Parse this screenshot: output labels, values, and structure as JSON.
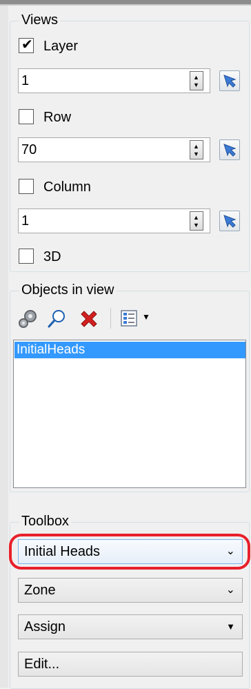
{
  "views": {
    "title": "Views",
    "layer": {
      "label": "Layer",
      "checked": true,
      "value": "1"
    },
    "row": {
      "label": "Row",
      "checked": false,
      "value": "70"
    },
    "column": {
      "label": "Column",
      "checked": false,
      "value": "1"
    },
    "three_d": {
      "label": "3D",
      "checked": false
    }
  },
  "objects": {
    "title": "Objects in view",
    "toolbar": [
      "gears-icon",
      "magnifier-icon",
      "delete-icon",
      "list-view-icon",
      "dropdown-arrow-icon"
    ],
    "items": [
      "InitialHeads"
    ]
  },
  "toolbox": {
    "title": "Toolbox",
    "parameter_select": "Initial Heads",
    "mode_select": "Zone",
    "action_select": "Assign",
    "edit_button": "Edit..."
  },
  "colors": {
    "selection": "#3399ff",
    "highlight": "#e8202a",
    "delete": "#d42020"
  }
}
